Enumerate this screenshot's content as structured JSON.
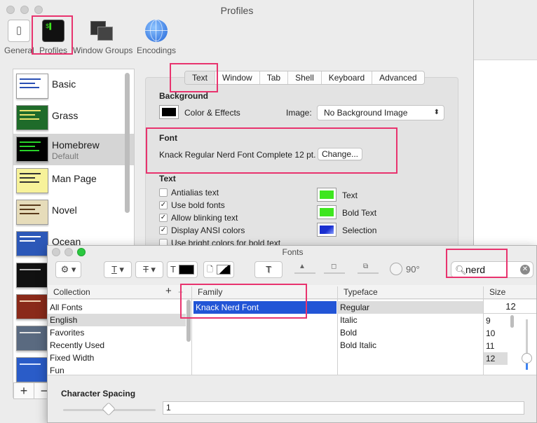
{
  "window": {
    "title": "Profiles"
  },
  "toolbar": {
    "items": [
      {
        "label": "General"
      },
      {
        "label": "Profiles"
      },
      {
        "label": "Window Groups"
      },
      {
        "label": "Encodings"
      }
    ]
  },
  "profiles": [
    {
      "name": "Basic",
      "subtitle": "",
      "bg": "#ffffff",
      "fg": "#2a4fb4"
    },
    {
      "name": "Grass",
      "subtitle": "",
      "bg": "#1f6b2a",
      "fg": "#e9e36a"
    },
    {
      "name": "Homebrew",
      "subtitle": "Default",
      "bg": "#000000",
      "fg": "#29d329"
    },
    {
      "name": "Man Page",
      "subtitle": "",
      "bg": "#f7f29a",
      "fg": "#333333"
    },
    {
      "name": "Novel",
      "subtitle": "",
      "bg": "#e6dcba",
      "fg": "#5a3a1a"
    },
    {
      "name": "Ocean",
      "subtitle": "",
      "bg": "#2c58b8",
      "fg": "#ffffff"
    },
    {
      "name": "",
      "subtitle": "",
      "bg": "#111111",
      "fg": "#bbbbbb"
    },
    {
      "name": "",
      "subtitle": "",
      "bg": "#8a2a1a",
      "fg": "#f1d1b1"
    },
    {
      "name": "",
      "subtitle": "",
      "bg": "#5a6a80",
      "fg": "#e2e2e2"
    },
    {
      "name": "",
      "subtitle": "",
      "bg": "#2a5cc8",
      "fg": "#dce6ff"
    }
  ],
  "list_buttons": {
    "add": "+",
    "remove": "−"
  },
  "tabs": [
    "Text",
    "Window",
    "Tab",
    "Shell",
    "Keyboard",
    "Advanced"
  ],
  "background": {
    "heading": "Background",
    "color_effects_label": "Color & Effects",
    "image_label": "Image:",
    "image_value": "No Background Image"
  },
  "font": {
    "heading": "Font",
    "current": "Knack Regular Nerd Font Complete 12 pt.",
    "change_button": "Change..."
  },
  "text_section": {
    "heading": "Text",
    "checkboxes": [
      {
        "label": "Antialias text",
        "checked": false
      },
      {
        "label": "Use bold fonts",
        "checked": true
      },
      {
        "label": "Allow blinking text",
        "checked": true
      },
      {
        "label": "Display ANSI colors",
        "checked": true
      },
      {
        "label": "Use bright colors for bold text",
        "checked": false
      }
    ],
    "colors": [
      {
        "label": "Text",
        "color": "#3ee61e"
      },
      {
        "label": "Bold Text",
        "color": "#3ee61e"
      },
      {
        "label": "Selection",
        "color": "#1a2fd0"
      }
    ]
  },
  "fonts_panel": {
    "title": "Fonts",
    "search_value": "nerd",
    "rotation": "90°",
    "columns": {
      "collection": "Collection",
      "family": "Family",
      "typeface": "Typeface",
      "size": "Size"
    },
    "collections": [
      "All Fonts",
      "English",
      "Favorites",
      "Recently Used",
      "Fixed Width",
      "Fun"
    ],
    "families": [
      "Knack Nerd Font"
    ],
    "typefaces": [
      "Regular",
      "Italic",
      "Bold",
      "Bold Italic"
    ],
    "size_value": "12",
    "sizes": [
      "9",
      "10",
      "11",
      "12"
    ],
    "character_spacing_label": "Character Spacing",
    "character_spacing_value": "1"
  },
  "colors": {
    "highlight": "#e8336e",
    "selection_blue": "#2255d6"
  }
}
